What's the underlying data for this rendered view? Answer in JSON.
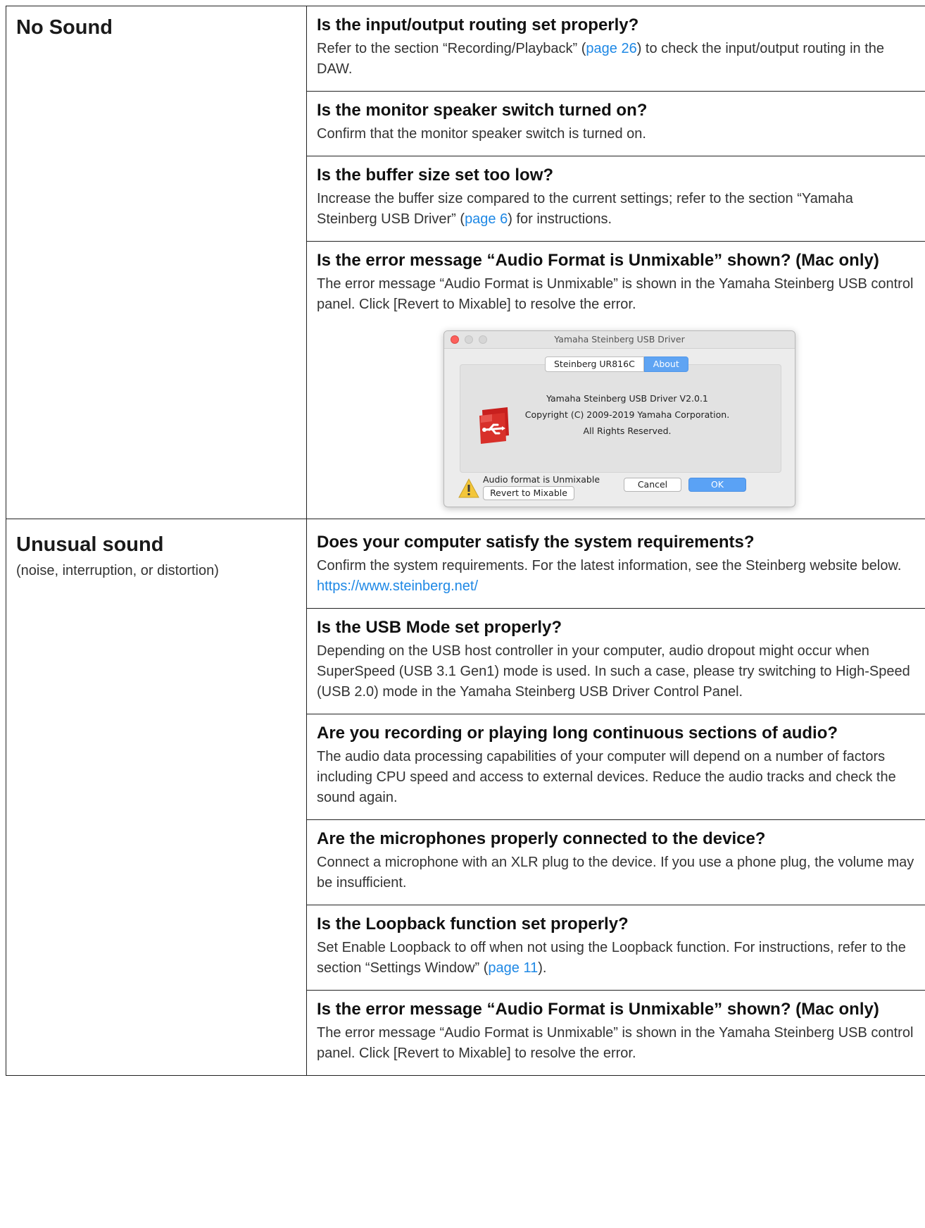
{
  "sections": [
    {
      "category": "No Sound",
      "subtitle": "",
      "items": [
        {
          "q": "Is the input/output routing set properly?",
          "a1": "Refer to the section “Recording/Playback” (",
          "link": "page 26",
          "a2": ") to check the input/output routing in the DAW."
        },
        {
          "q": "Is the monitor speaker switch turned on?",
          "a1": "Confirm that the monitor speaker switch is turned on."
        },
        {
          "q": "Is the buffer size set too low?",
          "a1": "Increase the buffer size compared to the current settings; refer to the section “Yamaha Steinberg USB Driver” (",
          "link": "page 6",
          "a2": ") for instructions."
        },
        {
          "q": "Is the error message “Audio Format is Unmixable” shown? (Mac only)",
          "a1": "The error message “Audio Format is Unmixable” is shown in the Yamaha Steinberg USB control panel. Click [Revert to Mixable] to resolve the error."
        }
      ]
    },
    {
      "category": "Unusual sound",
      "subtitle": "(noise, interruption, or distortion)",
      "items": [
        {
          "q": "Does your computer satisfy the system requirements?",
          "a1": "Confirm the system requirements. For the latest information, see the Steinberg website below.",
          "url": "https://www.steinberg.net/"
        },
        {
          "q": "Is the USB Mode set properly?",
          "a1": "Depending on the USB host controller in your computer, audio dropout might occur when SuperSpeed (USB 3.1 Gen1) mode is used. In such a case, please try switching to High-Speed (USB 2.0) mode in the Yamaha Steinberg USB Driver Control Panel."
        },
        {
          "q": "Are you recording or playing long continuous sections of audio?",
          "a1": "The audio data processing capabilities of your computer will depend on a number of factors including CPU speed and access to external devices. Reduce the audio tracks and check the sound again."
        },
        {
          "q": "Are the microphones properly connected to the device?",
          "a1": "Connect a microphone with an XLR plug to the device. If you use a phone plug, the volume may be insufficient."
        },
        {
          "q": "Is the Loopback function set properly?",
          "a1": "Set Enable Loopback to off when not using the Loopback function. For instructions, refer to the section “Settings Window” (",
          "link": "page 11",
          "a2": ")."
        },
        {
          "q": "Is the error message “Audio Format is Unmixable” shown? (Mac only)",
          "a1": "The error message “Audio Format is Unmixable” is shown in the Yamaha Steinberg USB control panel. Click [Revert to Mixable] to resolve the error."
        }
      ]
    }
  ],
  "dialog": {
    "title": "Yamaha Steinberg USB Driver",
    "tab_device": "Steinberg UR816C",
    "tab_about": "About",
    "line1": "Yamaha Steinberg USB Driver V2.0.1",
    "line2": "Copyright (C) 2009-2019 Yamaha Corporation.",
    "line3": "All Rights Reserved.",
    "warning_text": "Audio format is Unmixable",
    "revert_label": "Revert to Mixable",
    "cancel_label": "Cancel",
    "ok_label": "OK",
    "icon_usb": "usb-driver-icon",
    "icon_warning": "warning-icon",
    "accent_color": "#5fa4f3"
  },
  "link_color": "#1e88e5"
}
